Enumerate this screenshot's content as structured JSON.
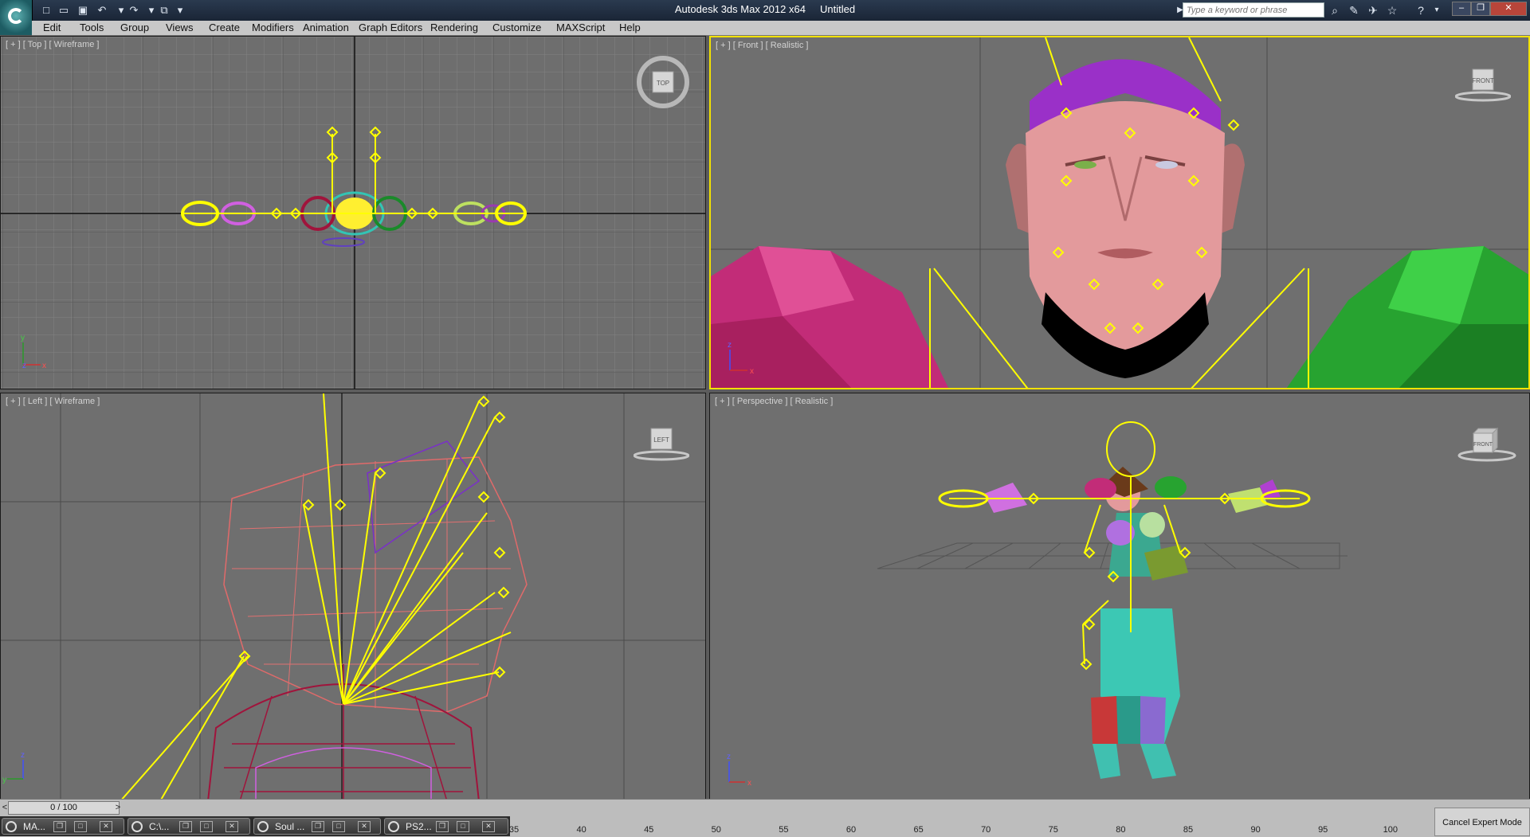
{
  "window": {
    "app_title": "Autodesk 3ds Max  2012 x64",
    "file_title": "Untitled",
    "search_placeholder": "Type a keyword or phrase"
  },
  "menu": [
    "Edit",
    "Tools",
    "Group",
    "Views",
    "Create",
    "Modifiers",
    "Animation",
    "Graph Editors",
    "Rendering",
    "Customize",
    "MAXScript",
    "Help"
  ],
  "viewports": {
    "top": {
      "label": "[ + ] [ Top ] [ Wireframe ]",
      "cube": "TOP"
    },
    "front": {
      "label": "[ + ] [ Front ] [ Realistic ]",
      "cube": "FRONT"
    },
    "left": {
      "label": "[ + ] [ Left ] [ Wireframe ]",
      "cube": "LEFT"
    },
    "perspective": {
      "label": "[ + ] [ Perspective ] [ Realistic ]",
      "cube": "FRONT"
    }
  },
  "axes": {
    "x": "x",
    "y": "y",
    "z": "z"
  },
  "timeline": {
    "frame": "0 / 100",
    "prev": "<",
    "next": ">",
    "ticks": [
      "35",
      "40",
      "45",
      "50",
      "55",
      "60",
      "65",
      "70",
      "75",
      "80",
      "85",
      "90",
      "95",
      "100"
    ]
  },
  "taskbar": [
    {
      "label": "MA..."
    },
    {
      "label": "C:\\..."
    },
    {
      "label": "Soul ..."
    },
    {
      "label": "PS2..."
    }
  ],
  "status": {
    "cancel_expert": "Cancel Expert Mode"
  },
  "colors": {
    "active_border": "#f2e200",
    "bone": "#ffff00",
    "viewport_bg": "#6e6e6e"
  }
}
